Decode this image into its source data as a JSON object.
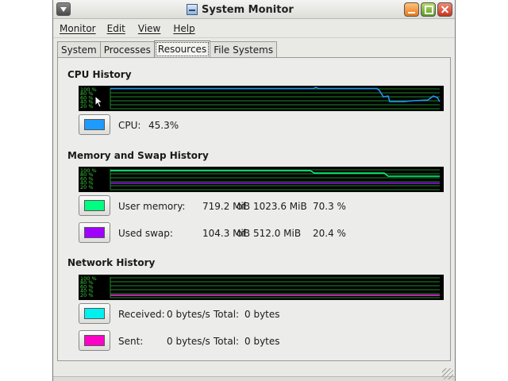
{
  "window": {
    "title": "System Monitor"
  },
  "menubar": {
    "items": [
      "Monitor",
      "Edit",
      "View",
      "Help"
    ]
  },
  "tabs": [
    {
      "label": "System",
      "active": false
    },
    {
      "label": "Processes",
      "active": false
    },
    {
      "label": "Resources",
      "active": true
    },
    {
      "label": "File Systems",
      "active": false
    }
  ],
  "cpu": {
    "section_title": "CPU History",
    "label": "CPU:",
    "value": "45.3%",
    "color": "#1e9bff"
  },
  "memory": {
    "section_title": "Memory and Swap History",
    "user": {
      "label": "User memory:",
      "used": "719.2 MiB",
      "of": "of",
      "total": "1023.6 MiB",
      "percent": "70.3 %",
      "color": "#00ff80"
    },
    "swap": {
      "label": "Used swap:",
      "used": "104.3 MiB",
      "of": "of",
      "total": "512.0 MiB",
      "percent": "20.4 %",
      "color": "#a000ff"
    }
  },
  "network": {
    "section_title": "Network History",
    "received": {
      "label": "Received:",
      "rate": "0 bytes/s",
      "total_label": "Total:",
      "total": "0 bytes",
      "color": "#00f0f0"
    },
    "sent": {
      "label": "Sent:",
      "rate": "0 bytes/s",
      "total_label": "Total:",
      "total": "0 bytes",
      "color": "#ff00c8"
    }
  },
  "graph_axis_labels": [
    "100 %",
    "80 %",
    "60 %",
    "40 %",
    "20 %"
  ],
  "colors": {
    "graph_bg": "#000000",
    "grid": "#1e8a2a",
    "axis_text": "#3cc83c"
  }
}
